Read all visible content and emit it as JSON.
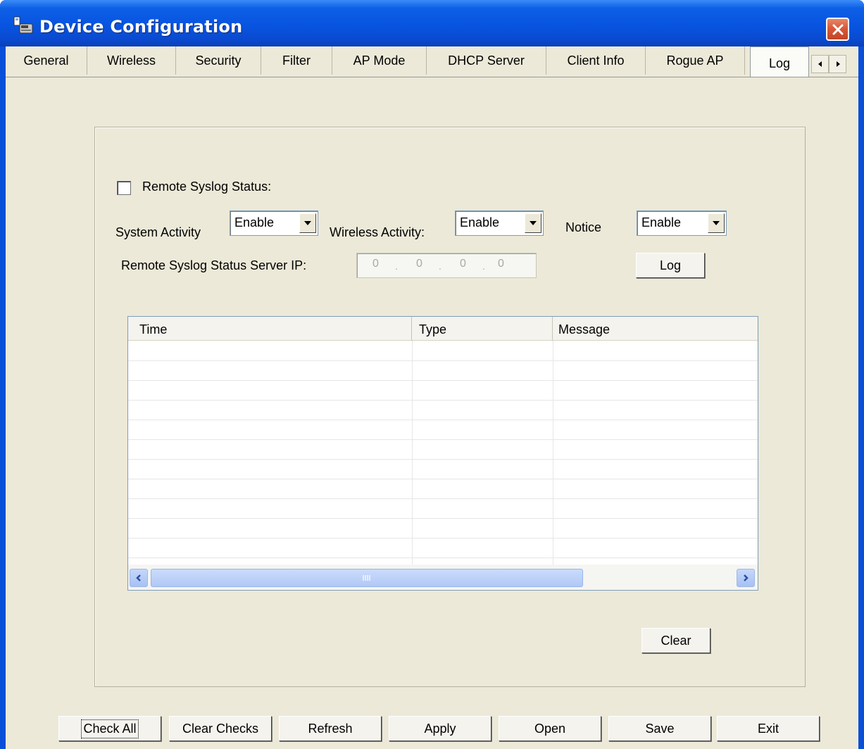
{
  "window": {
    "title": "Device Configuration"
  },
  "tabs": [
    {
      "label": "General"
    },
    {
      "label": "Wireless"
    },
    {
      "label": "Security"
    },
    {
      "label": "Filter"
    },
    {
      "label": "AP Mode"
    },
    {
      "label": "DHCP Server"
    },
    {
      "label": "Client Info"
    },
    {
      "label": "Rogue AP"
    },
    {
      "label": "Log",
      "active": true
    }
  ],
  "log": {
    "remote_syslog_label": "Remote Syslog Status:",
    "remote_syslog_checked": false,
    "system_activity_label": "System Activity",
    "system_activity_value": "Enable",
    "wireless_activity_label": "Wireless Activity:",
    "wireless_activity_value": "Enable",
    "notice_label": "Notice",
    "notice_value": "Enable",
    "server_ip_label": "Remote Syslog Status Server IP:",
    "server_ip": [
      "0",
      "0",
      "0",
      "0"
    ],
    "log_button": "Log",
    "table": {
      "columns": [
        "Time",
        "Type",
        "Message"
      ],
      "rows": []
    },
    "clear_button": "Clear"
  },
  "footer_buttons": {
    "check_all": "Check All",
    "clear_checks": "Clear Checks",
    "refresh": "Refresh",
    "apply": "Apply",
    "open": "Open",
    "save": "Save",
    "exit": "Exit"
  },
  "colors": {
    "titlebar": "#0854e0",
    "client_bg": "#ece9d8",
    "close_button": "#d65a3a",
    "scroll_thumb": "#b1c8f5"
  }
}
